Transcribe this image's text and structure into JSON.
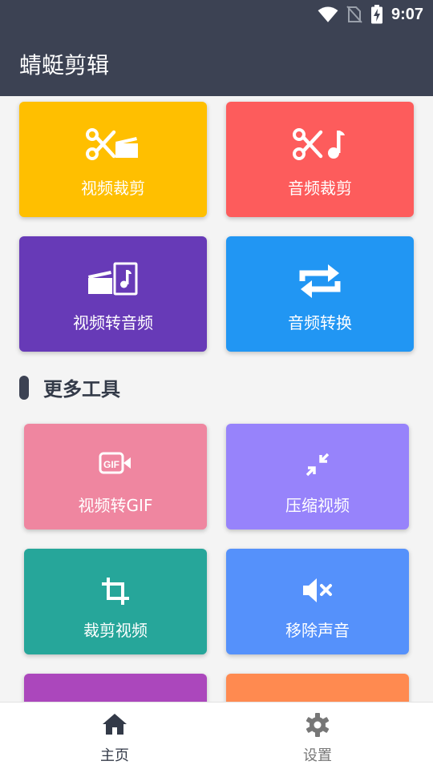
{
  "status": {
    "time": "9:07"
  },
  "app": {
    "title": "蜻蜓剪辑"
  },
  "main_tools": [
    {
      "label": "视频裁剪",
      "icon": "video-cut-icon",
      "color": "#ffbf00"
    },
    {
      "label": "音频裁剪",
      "icon": "audio-cut-icon",
      "color": "#fd5c5c"
    },
    {
      "label": "视频转音频",
      "icon": "video-to-audio-icon",
      "color": "#673ab7"
    },
    {
      "label": "音频转换",
      "icon": "repeat-icon",
      "color": "#2196f3"
    }
  ],
  "more_tools": {
    "title": "更多工具",
    "items": [
      {
        "label": "视频转GIF",
        "icon": "gif-icon",
        "color": "#ef86a0"
      },
      {
        "label": "压缩视频",
        "icon": "compress-icon",
        "color": "#9783fb"
      },
      {
        "label": "裁剪视频",
        "icon": "crop-icon",
        "color": "#26a69a"
      },
      {
        "label": "移除声音",
        "icon": "mute-icon",
        "color": "#5591fb"
      },
      {
        "label": "",
        "icon": "",
        "color": "#ab47bc"
      },
      {
        "label": "",
        "icon": "",
        "color": "#ff8a50"
      }
    ]
  },
  "bottom_nav": [
    {
      "label": "主页",
      "icon": "home-icon",
      "active": true
    },
    {
      "label": "设置",
      "icon": "gear-icon",
      "active": false
    }
  ],
  "colors": {
    "appbar": "#3c4253",
    "nav_active": "#333a48",
    "nav_inactive": "#777777"
  }
}
